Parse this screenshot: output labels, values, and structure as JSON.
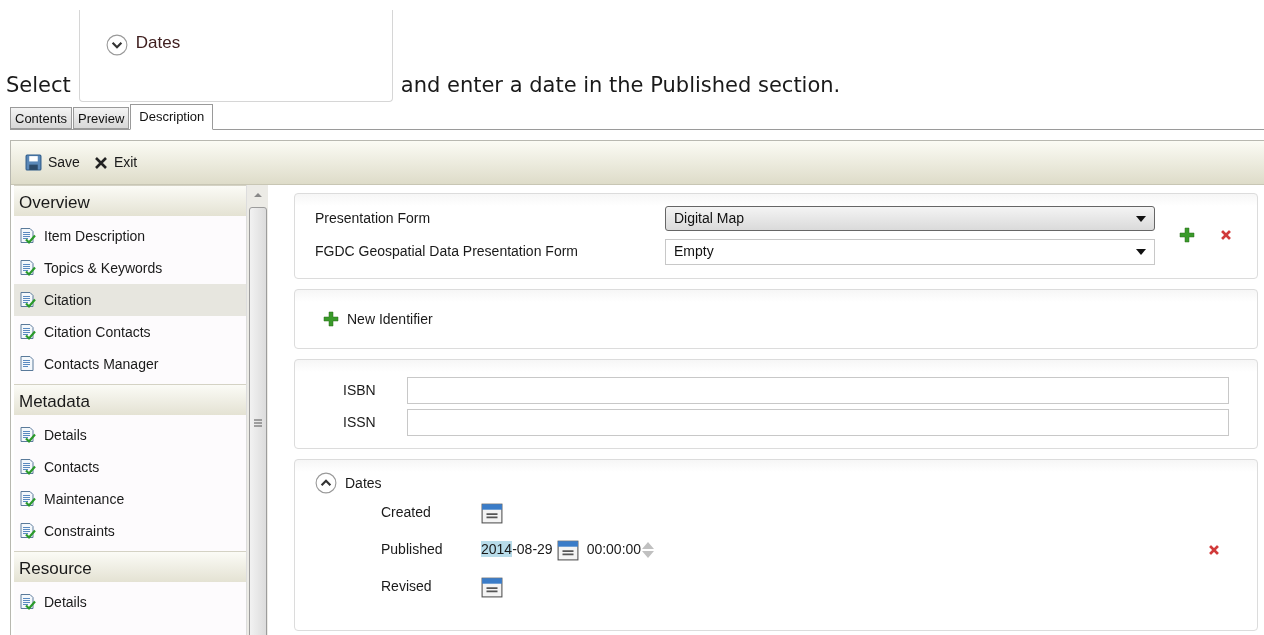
{
  "instruction": {
    "before": "Select",
    "inset": {
      "label": "Dates",
      "expanded": false
    },
    "after": "and enter a date in the Published section."
  },
  "tabs": [
    {
      "label": "Contents",
      "selected": false
    },
    {
      "label": "Preview",
      "selected": false
    },
    {
      "label": "Description",
      "selected": true
    }
  ],
  "toolbar": [
    {
      "kind": "save",
      "label": "Save"
    },
    {
      "kind": "exit",
      "label": "Exit"
    }
  ],
  "sidebar": {
    "groups": [
      {
        "title": "Overview",
        "items": [
          {
            "label": "Item Description",
            "selected": false,
            "complete": true
          },
          {
            "label": "Topics & Keywords",
            "selected": false,
            "complete": true
          },
          {
            "label": "Citation",
            "selected": true,
            "complete": true
          },
          {
            "label": "Citation Contacts",
            "selected": false,
            "complete": true
          },
          {
            "label": "Contacts Manager",
            "selected": false,
            "complete": false
          }
        ]
      },
      {
        "title": "Metadata",
        "items": [
          {
            "label": "Details",
            "selected": false,
            "complete": true
          },
          {
            "label": "Contacts",
            "selected": false,
            "complete": true
          },
          {
            "label": "Maintenance",
            "selected": false,
            "complete": true
          },
          {
            "label": "Constraints",
            "selected": false,
            "complete": true
          }
        ]
      },
      {
        "title": "Resource",
        "items": [
          {
            "label": "Details",
            "selected": false,
            "complete": true
          }
        ]
      }
    ]
  },
  "presentation": {
    "fields": [
      {
        "label": "Presentation Form",
        "value": "Digital Map",
        "focused": true
      },
      {
        "label": "FGDC Geospatial Data Presentation Form",
        "value": "Empty",
        "focused": false
      }
    ]
  },
  "identifier": {
    "add_label": "New Identifier"
  },
  "codes": [
    {
      "label": "ISBN"
    },
    {
      "label": "ISSN"
    }
  ],
  "dates": {
    "title": "Dates",
    "expanded": true,
    "rows": [
      {
        "label": "Created",
        "kind": "empty"
      },
      {
        "label": "Published",
        "kind": "set",
        "date_selected": "2014",
        "date_rest": "-08-29",
        "time": "00:00:00"
      },
      {
        "label": "Revised",
        "kind": "empty"
      }
    ]
  }
}
